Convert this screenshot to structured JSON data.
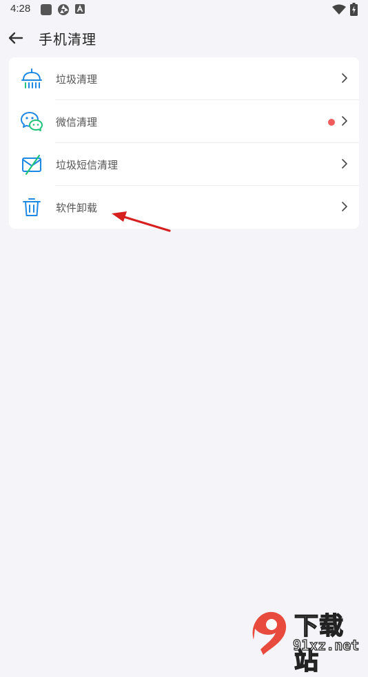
{
  "status_bar": {
    "time": "4:28",
    "icons": [
      "square-notification-icon",
      "aperture-icon",
      "a-badge-icon",
      "wifi-icon",
      "battery-charging-icon"
    ]
  },
  "app_bar": {
    "back_icon": "arrow-left-icon",
    "title": "手机清理"
  },
  "menu": {
    "items": [
      {
        "label": "垃圾清理",
        "icon": "shower-broom-icon",
        "badge": false
      },
      {
        "label": "微信清理",
        "icon": "wechat-icon",
        "badge": true,
        "badge_color": "#f25b5b"
      },
      {
        "label": "垃圾短信清理",
        "icon": "message-blocked-icon",
        "badge": false
      },
      {
        "label": "软件卸载",
        "icon": "trash-icon",
        "badge": false
      }
    ]
  },
  "colors": {
    "accent": "#1e88e5",
    "green": "#1fc47b",
    "background": "#f5f5f9",
    "annotation_arrow": "#d61f1f"
  },
  "watermark": {
    "logo_glyph": "9",
    "text_cn": "下载站",
    "text_en": "91xz.net"
  }
}
